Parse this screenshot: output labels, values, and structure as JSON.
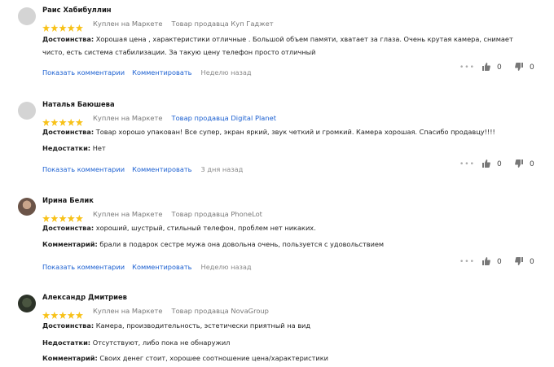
{
  "labels": {
    "purchased": "Куплен на Маркете",
    "pros": "Достоинства:",
    "cons": "Недостатки:",
    "comment": "Комментарий:",
    "show_comments": "Показать комментарии",
    "write_comment": "Комментировать"
  },
  "colors": {
    "star": "#f8c21a",
    "link": "#1a5fd1",
    "muted": "#777777"
  },
  "reviews": [
    {
      "author": "Раис Хабибуллин",
      "rating": 5,
      "seller": "Товар продавца Куп Гаджет",
      "pros": "Хорошая цена , характеристики отличные . Большой объем памяти, хватает за глаза. Очень крутая камера, снимает чисто, есть система стабилизации. За такую цену телефон просто отличный",
      "date": "Неделю назад",
      "likes": "0",
      "dislikes": "0"
    },
    {
      "author": "Наталья Баюшева",
      "rating": 5,
      "seller": "Товар продавца Digital Planet",
      "pros": "Товар хорошо упакован! Все супер, экран яркий, звук четкий и громкий. Камера хорошая. Спасибо продавцу!!!!",
      "cons": "Нет",
      "date": "3 дня назад",
      "likes": "0",
      "dislikes": "0"
    },
    {
      "author": "Ирина Белик",
      "rating": 5,
      "seller": "Товар продавца PhoneLot",
      "pros": "хороший, шустрый, стильный телефон, проблем нет никаких.",
      "comment": "брали в подарок сестре мужа она довольна очень, пользуется с удовольствием",
      "date": "Неделю назад",
      "likes": "0",
      "dislikes": "0"
    },
    {
      "author": "Александр Дмитриев",
      "rating": 5,
      "seller": "Товар продавца NovaGroup",
      "pros": "Камера, производительность, эстетически приятный на вид",
      "cons": "Отсутствуют, либо пока не обнаружил",
      "comment": "Своих денег стоит, хорошее соотношение цена/характеристики"
    }
  ]
}
